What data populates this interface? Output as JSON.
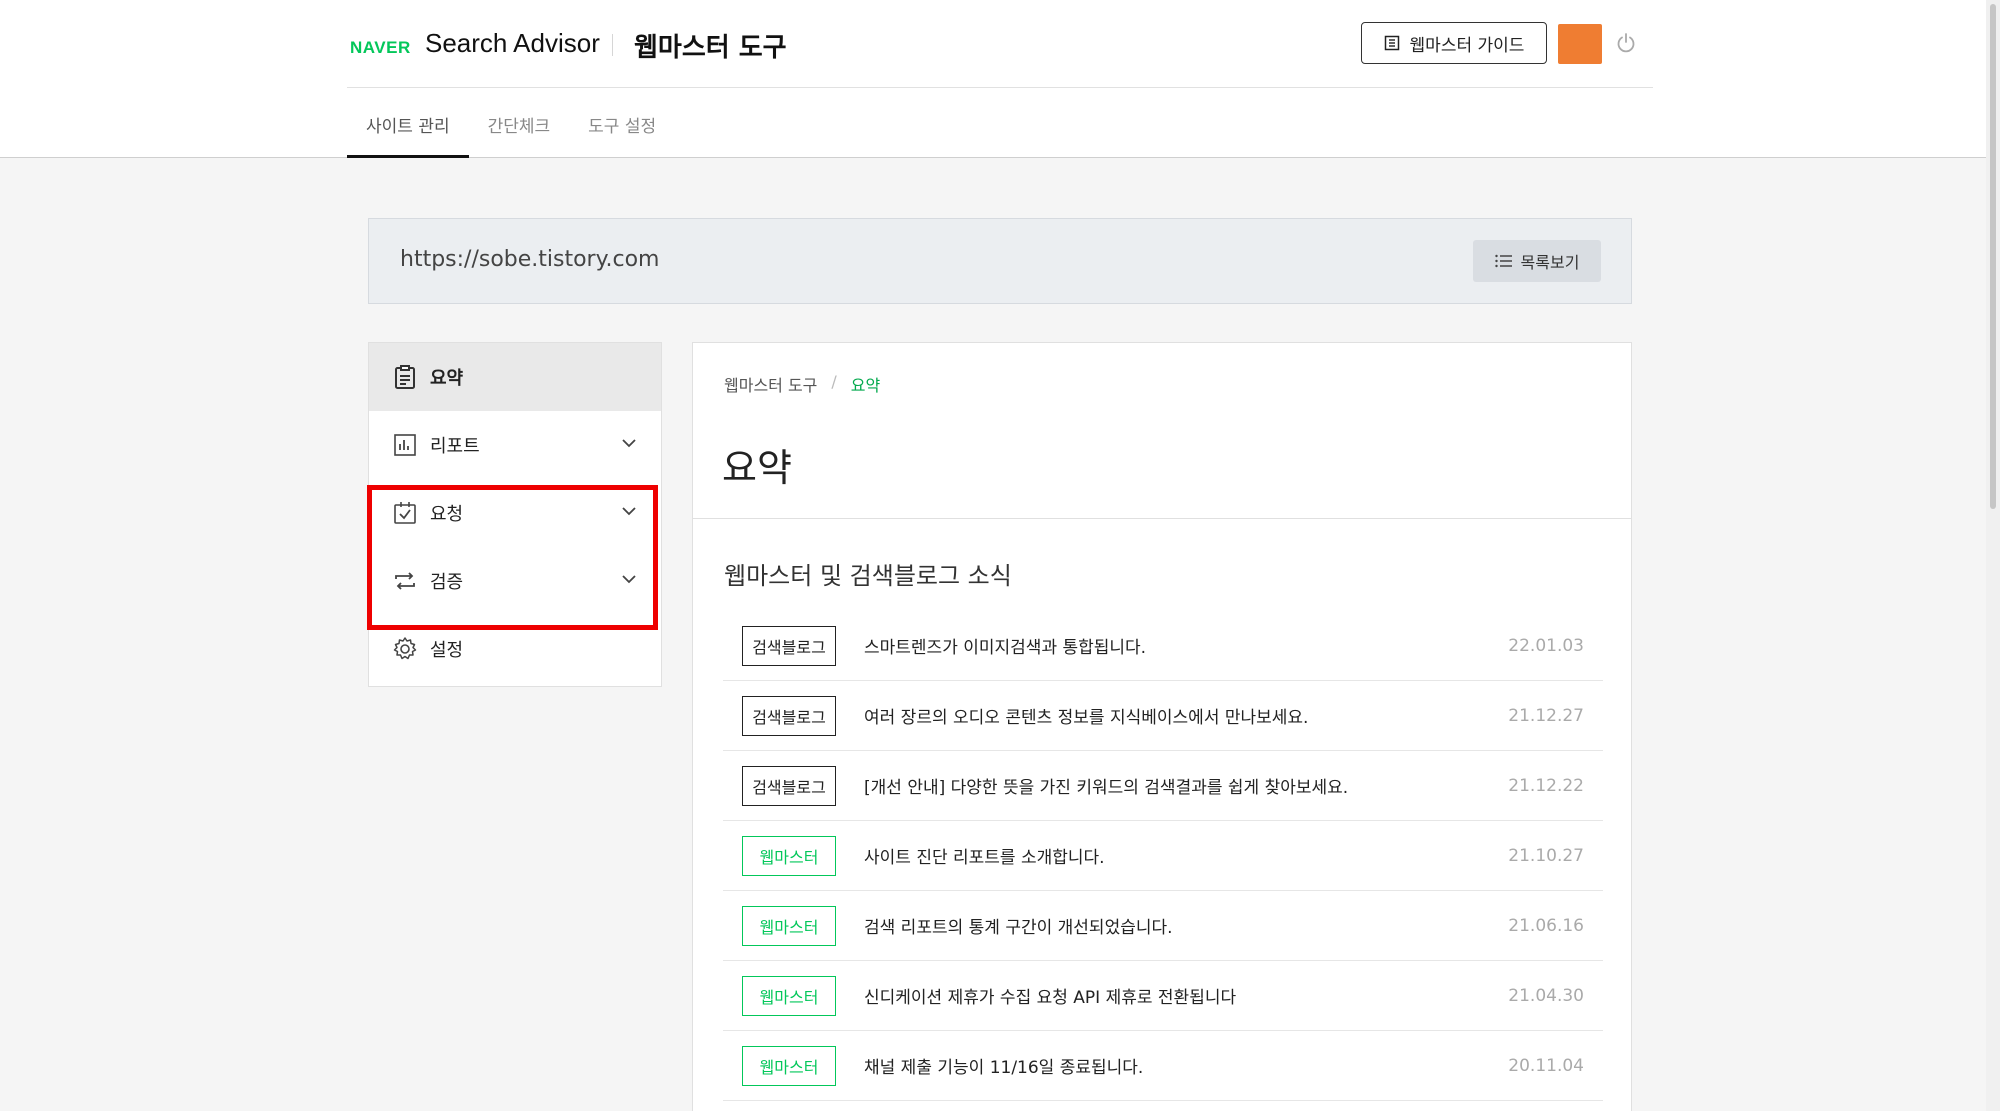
{
  "header": {
    "logo": "NAVER",
    "app_name": "Search Advisor",
    "tool_name": "웹마스터 도구",
    "guide_label": "웹마스터 가이드",
    "avatar_color": "#ef7d32"
  },
  "nav": {
    "tabs": [
      {
        "label": "사이트 관리"
      },
      {
        "label": "간단체크"
      },
      {
        "label": "도구 설정"
      }
    ]
  },
  "site": {
    "url": "https://sobe.tistory.com",
    "list_label": "목록보기"
  },
  "sidebar": {
    "items": [
      {
        "label": "요약",
        "icon": "clipboard-icon"
      },
      {
        "label": "리포트",
        "icon": "bar-chart-icon"
      },
      {
        "label": "요청",
        "icon": "checkbox-icon"
      },
      {
        "label": "검증",
        "icon": "repeat-icon"
      },
      {
        "label": "설정",
        "icon": "gear-icon"
      }
    ]
  },
  "main": {
    "breadcrumb": [
      "웹마스터 도구",
      "요약"
    ],
    "breadcrumb_sep": "/",
    "title": "요약",
    "news_title": "웹마스터 및 검색블로그 소식",
    "news": [
      {
        "tag": "검색블로그",
        "text": "스마트렌즈가 이미지검색과 통합됩니다.",
        "date": "22.01.03"
      },
      {
        "tag": "검색블로그",
        "text": "여러 장르의 오디오 콘텐츠 정보를 지식베이스에서 만나보세요.",
        "date": "21.12.27"
      },
      {
        "tag": "검색블로그",
        "text": "[개선 안내] 다양한 뜻을 가진 키워드의 검색결과를 쉽게 찾아보세요.",
        "date": "21.12.22"
      },
      {
        "tag": "웹마스터",
        "text": "사이트 진단 리포트를 소개합니다.",
        "date": "21.10.27"
      },
      {
        "tag": "웹마스터",
        "text": "검색 리포트의 통계 구간이 개선되었습니다.",
        "date": "21.06.16"
      },
      {
        "tag": "웹마스터",
        "text": "신디케이션 제휴가 수집 요청 API 제휴로 전환됩니다",
        "date": "21.04.30"
      },
      {
        "tag": "웹마스터",
        "text": "채널 제출 기능이 11/16일 종료됩니다.",
        "date": "20.11.04"
      }
    ]
  },
  "colors": {
    "brand_green": "#03c75a",
    "highlight_red": "#ee0000"
  }
}
